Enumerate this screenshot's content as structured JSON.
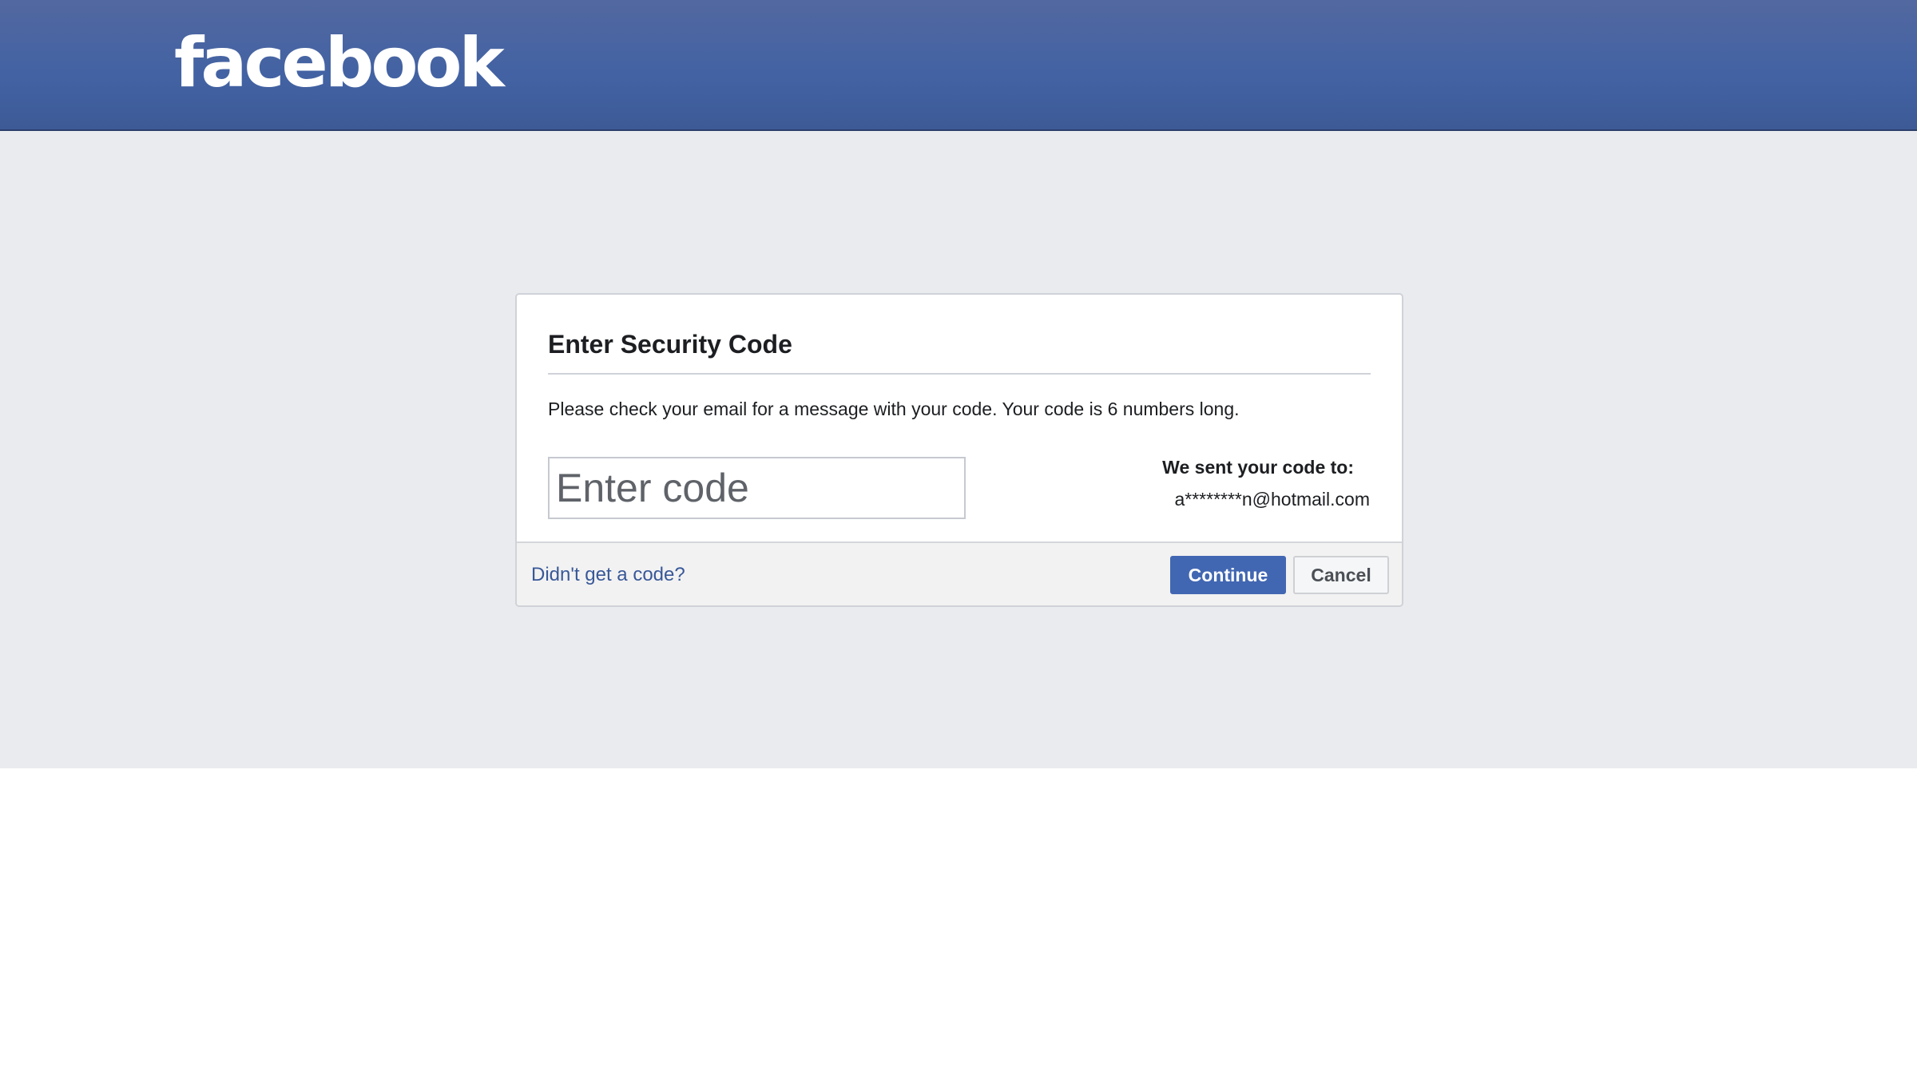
{
  "header": {
    "logo_text": "facebook",
    "colors": {
      "bar": "#4262a3",
      "text": "#ffffff"
    }
  },
  "dialog": {
    "title": "Enter Security Code",
    "instructions": "Please check your email for a message with your code. Your code is 6 numbers long.",
    "code_input": {
      "value": "",
      "placeholder": "Enter code"
    },
    "sent_to": {
      "label": "We sent your code to:",
      "email": "a********n@hotmail.com"
    },
    "footer": {
      "no_code_link": "Didn't get a code?",
      "continue_label": "Continue",
      "cancel_label": "Cancel"
    },
    "colors": {
      "primary_button": "#4267b2",
      "link": "#385898",
      "page_background": "#e9ebee"
    }
  }
}
